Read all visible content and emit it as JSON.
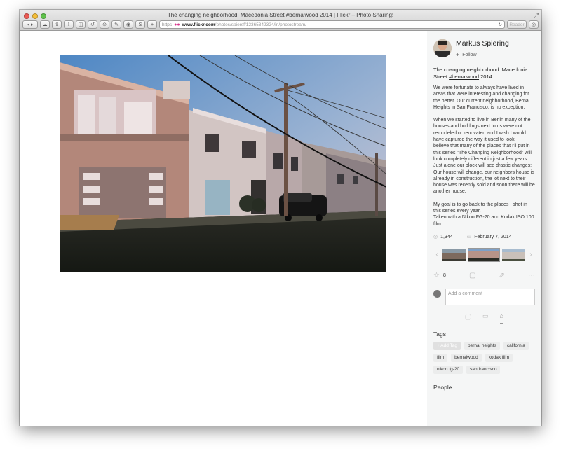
{
  "window": {
    "title": "The changing neighborhood: Macedonia Street #bernalwood 2014 | Flickr – Photo Sharing!"
  },
  "toolbar": {
    "back": "◀",
    "forward": "▶",
    "url_scheme": "https",
    "url_host": "www.flickr.com",
    "url_path": "/photos/spiersf/12365342324/in/photostream/",
    "reader_label": "Reader"
  },
  "author": {
    "name": "Markus Spiering",
    "follow_label": "Follow"
  },
  "photo": {
    "title_prefix": "The changing neighborhood: Macedonia Street ",
    "title_hashtag": "#bernalwood",
    "title_suffix": " 2014",
    "description": [
      "We were fortunate to always have lived in areas that were interesting and changing for the better. Our current neighborhood, Bernal Heights in San Francisco, is no exception.",
      "When we started to live in Berlin many of the houses and buildings next to us were not remodeled or renovated and I wish I would have captured the way it used to look. I believe that many of the places that I'll put in this series \"The Changing Neighborhood\" will look completely different in just a few years. Just alone our block will see drastic changes: Our house will change, our neighbors house is already in construction, the lot next to their house was recently sold and soon there will be another house.",
      "My goal is to go back to the places I shot in this series every year.",
      "Taken with a Nikon FG-20 and Kodak ISO 100 film."
    ],
    "views": "1,344",
    "date": "February 7, 2014",
    "favorites": "8"
  },
  "comment": {
    "placeholder": "Add a comment"
  },
  "tags": {
    "heading": "Tags",
    "add_label": "+ Add Tag",
    "items": [
      "bernal heights",
      "california",
      "film",
      "bernalwood",
      "kodak film",
      "nikon fg-20",
      "san francisco"
    ]
  },
  "people": {
    "heading": "People"
  }
}
